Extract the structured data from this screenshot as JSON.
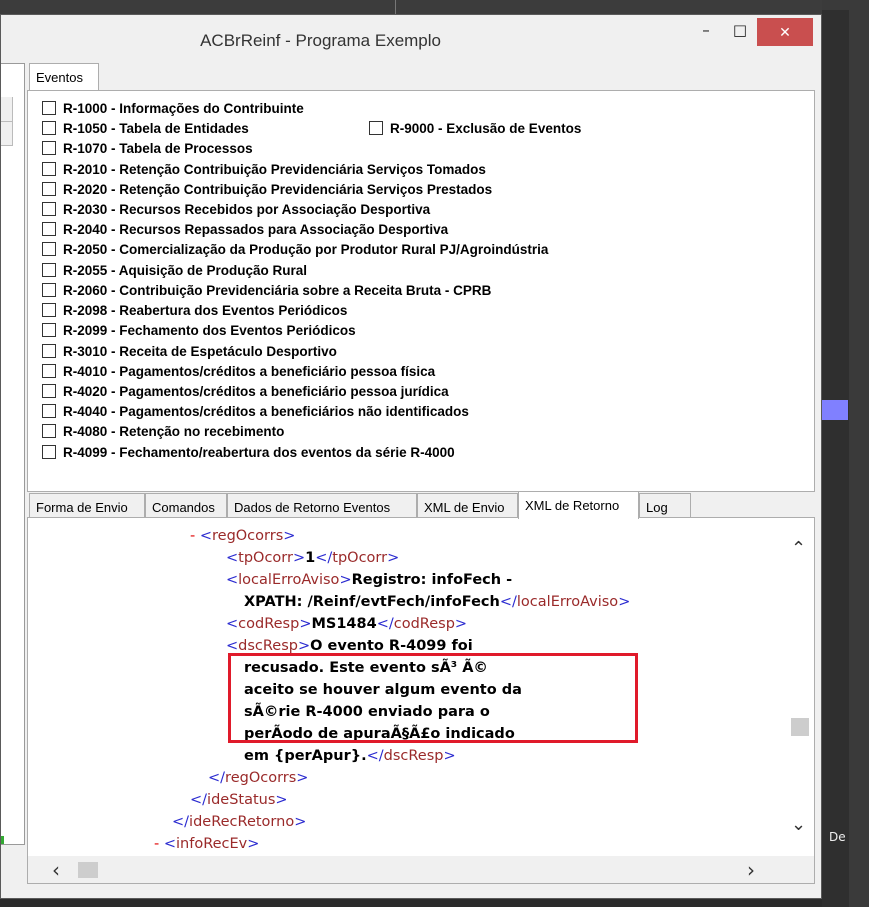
{
  "window": {
    "title": "ACBrReinf - Programa Exemplo",
    "minimize_glyph": "–",
    "maximize_glyph": "□",
    "close_glyph": "✕"
  },
  "background": {
    "right_label": "De"
  },
  "main_tab": "Eventos",
  "events": [
    "R-1000 - Informações do Contribuinte",
    "R-1050 - Tabela de Entidades",
    "R-1070 - Tabela de Processos",
    "R-2010 - Retenção Contribuição Previdenciária  Serviços Tomados",
    "R-2020 - Retenção Contribuição Previdenciária  Serviços Prestados",
    "R-2030 - Recursos Recebidos por Associação Desportiva",
    "R-2040 - Recursos Repassados para Associação Desportiva",
    "R-2050 - Comercialização da Produção por Produtor Rural PJ/Agroindústria",
    "R-2055 - Aquisição de Produção Rural",
    "R-2060 - Contribuição Previdenciária sobre a Receita Bruta - CPRB",
    "R-2098 - Reabertura dos Eventos Periódicos",
    "R-2099 - Fechamento dos Eventos Periódicos",
    "R-3010 - Receita de Espetáculo Desportivo",
    "R-4010 - Pagamentos/créditos a beneficiário pessoa física",
    "R-4020 - Pagamentos/créditos a beneficiário pessoa jurídica",
    "R-4040 - Pagamentos/créditos a beneficiários não identificados",
    "R-4080 - Retenção no recebimento",
    "R-4099 - Fechamento/reabertura dos eventos da série R-4000"
  ],
  "event_extra": "R-9000 - Exclusão de Eventos",
  "bottom_tabs": [
    "Forma de Envio",
    "Comandos",
    "Dados de Retorno Eventos",
    "XML de Envio",
    "XML de Retorno",
    "Log"
  ],
  "active_bottom_tab": "XML de Retorno",
  "xml": {
    "collapse_glyph": "-",
    "reg_ocorrs_tag": "regOcorrs",
    "tp_ocorr_tag": "tpOcorr",
    "tp_ocorr_value": "1",
    "local_erro_tag": "localErroAviso",
    "local_erro_value_1": "Registro: infoFech -",
    "local_erro_value_2": "XPATH: /Reinf/evtFech/infoFech",
    "cod_resp_tag": "codResp",
    "cod_resp_value": "MS1484",
    "dsc_resp_tag": "dscResp",
    "dsc_resp_lines": [
      "O evento R-4099 foi",
      "recusado. Este evento sÃ³ Ã©",
      "aceito se houver algum evento da",
      "sÃ©rie R-4000 enviado para o",
      "perÃodo de apuraÃ§Ã£o indicado",
      "em {perApur}."
    ],
    "ide_status_tag": "ideStatus",
    "ide_rec_retorno_tag": "ideRecRetorno",
    "info_rec_ev_tag": "infoRecEv"
  },
  "scroll_glyphs": {
    "up": "⌃",
    "down": "⌄",
    "left": "‹",
    "right": "›"
  }
}
